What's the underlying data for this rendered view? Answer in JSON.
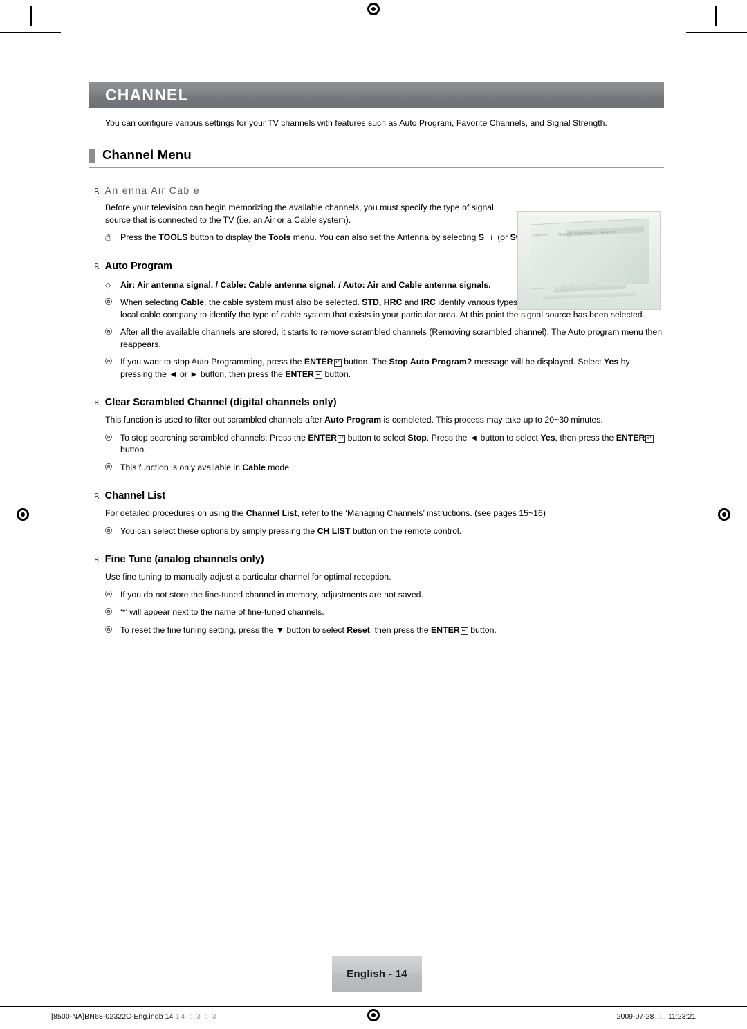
{
  "header": {
    "title": "CHANNEL",
    "intro": "You can configure various settings for your TV channels with features such as Auto Program, Favorite Channels, and Signal Strength."
  },
  "section": {
    "title": "Channel Menu"
  },
  "antenna": {
    "heading": "An enna    Air    Cab e",
    "para": "Before your television can begin memorizing the available channels, you must specify the type of signal source that is connected to the TV (i.e. an Air or a Cable system).",
    "tools_note_a": "Press the ",
    "tools_note_b": "TOOLS",
    "tools_note_c": " button to display the ",
    "tools_note_d": "Tools",
    "tools_note_e": " menu. You can also set the Antenna by selecting ",
    "tools_note_f": "S  i",
    "tools_note_g": " (or ",
    "tools_note_h": "Switch to Air",
    "tools_note_i": ")."
  },
  "auto_program": {
    "heading": "Auto Program",
    "signals_line": "Air: Air antenna signal. / Cable: Cable antenna signal. / Auto: Air and Cable antenna signals.",
    "notes": [
      {
        "parts": [
          {
            "t": "When selecting ",
            "b": false
          },
          {
            "t": "Cable",
            "b": true
          },
          {
            "t": ", the cable system must also be selected. ",
            "b": false
          },
          {
            "t": "STD, HRC",
            "b": true
          },
          {
            "t": " and ",
            "b": false
          },
          {
            "t": "IRC",
            "b": true
          },
          {
            "t": " identify various types of cable TV systems. Contact your local cable company to identify the type of cable system that exists in your particular area. At this point the signal source has been selected.",
            "b": false
          }
        ]
      },
      {
        "parts": [
          {
            "t": "After all the available channels are stored, it starts to remove scrambled channels (Removing scrambled channel). The Auto program menu then reappears.",
            "b": false
          }
        ]
      },
      {
        "parts": [
          {
            "t": "If you want to stop Auto Programming, press the ",
            "b": false
          },
          {
            "t": "ENTER",
            "b": true
          },
          {
            "t": "[ENTER-ICON]",
            "b": false
          },
          {
            "t": " button. The ",
            "b": false
          },
          {
            "t": "Stop Auto Program?",
            "b": true
          },
          {
            "t": " message will be displayed. Select ",
            "b": false
          },
          {
            "t": "Yes",
            "b": true
          },
          {
            "t": " by pressing the ◄ or ► button, then press the ",
            "b": false
          },
          {
            "t": "ENTER",
            "b": true
          },
          {
            "t": "[ENTER-ICON]",
            "b": false
          },
          {
            "t": " button.",
            "b": false
          }
        ]
      }
    ]
  },
  "clear_scrambled": {
    "heading": "Clear Scrambled Channel (digital channels only)",
    "para_parts": [
      {
        "t": "This function is used to filter out scrambled channels after ",
        "b": false
      },
      {
        "t": "Auto Program",
        "b": true
      },
      {
        "t": " is completed. This process may take up to 20~30 minutes.",
        "b": false
      }
    ],
    "notes": [
      {
        "parts": [
          {
            "t": "To stop searching scrambled channels: Press the ",
            "b": false
          },
          {
            "t": "ENTER",
            "b": true
          },
          {
            "t": "[ENTER-ICON]",
            "b": false
          },
          {
            "t": " button to select ",
            "b": false
          },
          {
            "t": "Stop",
            "b": true
          },
          {
            "t": ". Press the ◄ button to select ",
            "b": false
          },
          {
            "t": "Yes",
            "b": true
          },
          {
            "t": ", then press the ",
            "b": false
          },
          {
            "t": "ENTER",
            "b": true
          },
          {
            "t": "[ENTER-ICON]",
            "b": false
          },
          {
            "t": " button.",
            "b": false
          }
        ]
      },
      {
        "parts": [
          {
            "t": "This function is only available in ",
            "b": false
          },
          {
            "t": "Cable",
            "b": true
          },
          {
            "t": " mode.",
            "b": false
          }
        ]
      }
    ]
  },
  "channel_list": {
    "heading": "Channel List",
    "para_parts": [
      {
        "t": "For detailed procedures on using the ",
        "b": false
      },
      {
        "t": "Channel List",
        "b": true
      },
      {
        "t": ", refer to the ‘Managing Channels’ instructions. (see pages 15~16)",
        "b": false
      }
    ],
    "notes": [
      {
        "parts": [
          {
            "t": "You can select these options by simply pressing the ",
            "b": false
          },
          {
            "t": "CH LIST",
            "b": true
          },
          {
            "t": " button on the remote control.",
            "b": false
          }
        ]
      }
    ]
  },
  "fine_tune": {
    "heading": "Fine Tune (analog channels only)",
    "para": "Use fine tuning to manually adjust a particular channel for optimal reception.",
    "notes": [
      {
        "parts": [
          {
            "t": "If you do not store the fine-tuned channel in memory, adjustments are not saved.",
            "b": false
          }
        ]
      },
      {
        "parts": [
          {
            "t": "‘*’ will appear next to the name of fine-tuned channels.",
            "b": false
          }
        ]
      },
      {
        "parts": [
          {
            "t": "To reset the fine tuning setting, press the ▼ button to select ",
            "b": false
          },
          {
            "t": "Reset",
            "b": true
          },
          {
            "t": ", then press the ",
            "b": false
          },
          {
            "t": "ENTER",
            "b": true
          },
          {
            "t": "[ENTER-ICON]",
            "b": false
          },
          {
            "t": " button.",
            "b": false
          }
        ]
      }
    ]
  },
  "tv_figure": {
    "screen_rows": [
      "Nwaolk^n|Ixmwvpo^Nslwypw",
      "",
      ""
    ],
    "left_label": "Antenna",
    "glyphs": "□ □ □ □ □"
  },
  "footer": {
    "page_label": "English - 14",
    "file_info": "[8500-NA]BN68-02322C-Eng.indb   14",
    "file_info_dim": "14 : 3 : 3",
    "date": "2009-07-28",
    "time_sq": "□□",
    "time": "11:23:21"
  }
}
